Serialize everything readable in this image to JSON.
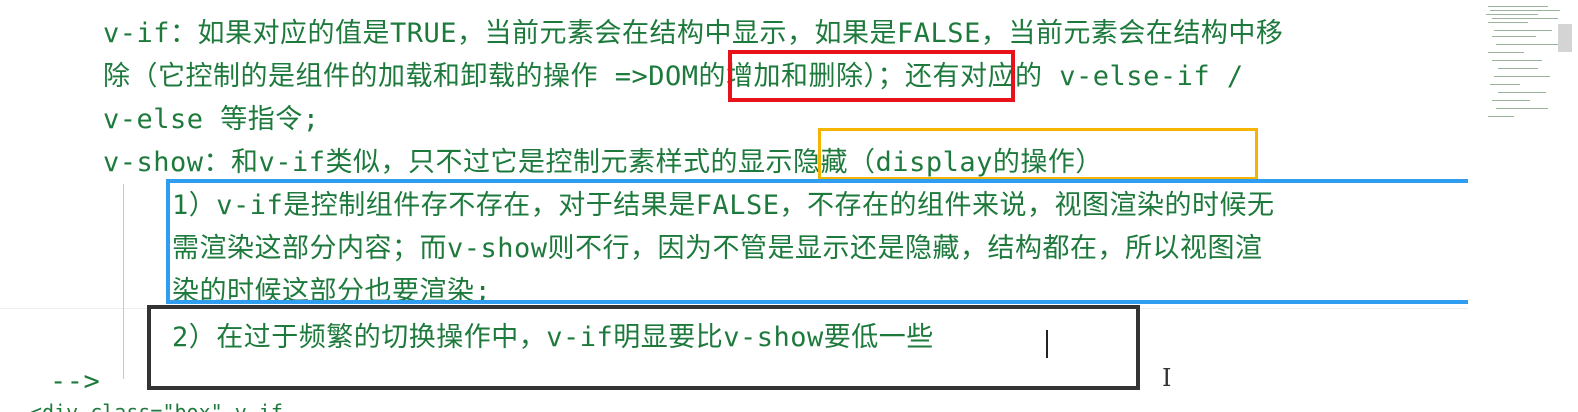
{
  "editor": {
    "lines": [
      "v-if：如果对应的值是TRUE，当前元素会在结构中显示，如果是FALSE，当前元素会在结构中移",
      "除（它控制的是组件的加载和卸载的操作 =>DOM的增加和删除）；还有对应的 v-else-if /",
      "v-else 等指令;",
      "v-show：和v-if类似，只不过它是控制元素样式的显示隐藏（display的操作）",
      "1）v-if是控制组件存不存在，对于结果是FALSE，不存在的组件来说，视图渲染的时候无",
      "需渲染这部分内容；而v-show则不行，因为不管是显示还是隐藏，结构都在，所以视图渲",
      "染的时候这部分也要渲染;",
      "2）在过于频繁的切换操作中，v-if明显要比v-show要低一些",
      "-->"
    ],
    "peek_line": "<div class=\"box\" v-if"
  },
  "annotations": {
    "red_box_color": "#e8121a",
    "orange_box_color": "#f5b400",
    "blue_box_color": "#2f9ef0",
    "black_box_color": "#333333"
  },
  "icons": {
    "text_cursor": "I"
  },
  "theme": {
    "text_color": "#1e7a3c",
    "background": "#ffffff"
  }
}
